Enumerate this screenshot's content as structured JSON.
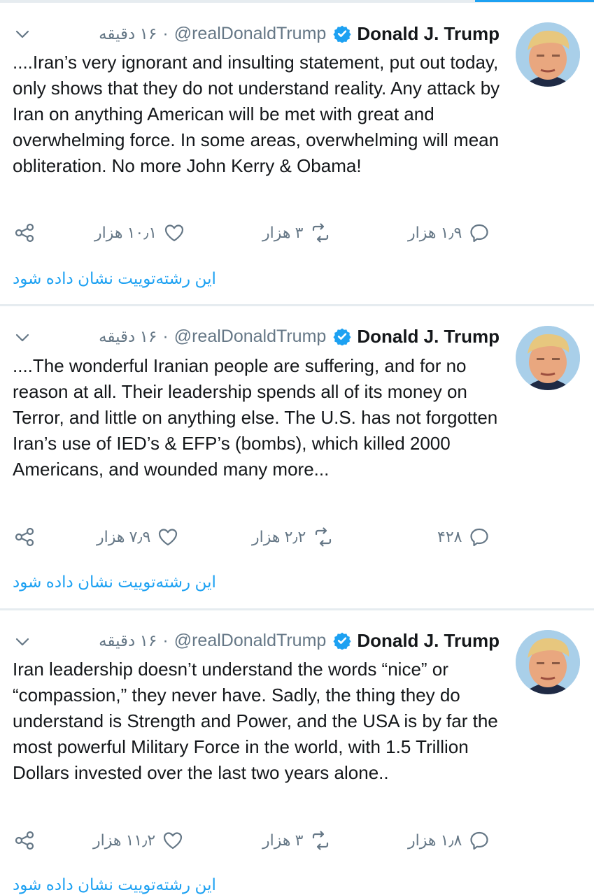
{
  "colors": {
    "accent": "#1da1f2",
    "muted": "#657786",
    "text": "#14171a",
    "divider": "#e6ecf0"
  },
  "tweets": [
    {
      "name": "Donald J. Trump",
      "handle": "@realDonaldTrump",
      "separator": "·",
      "time": "۱۶ دقیقه",
      "text": "....Iran’s very ignorant and insulting statement, put out today, only shows that they do not understand reality. Any attack by Iran on anything American will be met with great and overwhelming force. In some areas, overwhelming will mean obliteration. No more John Kerry & Obama!",
      "replies": "۱٫۹ هزار",
      "retweets": "۳ هزار",
      "likes": "۱۰٫۱ هزار",
      "show_thread": "این رشته‌توییت نشان داده شود",
      "icons": [
        "verified-badge-icon",
        "chevron-down-icon",
        "reply-icon",
        "retweet-icon",
        "like-icon",
        "share-icon"
      ]
    },
    {
      "name": "Donald J. Trump",
      "handle": "@realDonaldTrump",
      "separator": "·",
      "time": "۱۶ دقیقه",
      "text": "....The wonderful Iranian people are suffering, and for no reason at all. Their leadership spends all of its money on Terror, and little on anything else. The U.S. has not forgotten Iran’s use of IED’s & EFP’s (bombs), which killed 2000 Americans, and wounded many more...",
      "replies": "۴۲۸",
      "retweets": "۲٫۲ هزار",
      "likes": "۷٫۹ هزار",
      "show_thread": "این رشته‌توییت نشان داده شود",
      "icons": [
        "verified-badge-icon",
        "chevron-down-icon",
        "reply-icon",
        "retweet-icon",
        "like-icon",
        "share-icon"
      ]
    },
    {
      "name": "Donald J. Trump",
      "handle": "@realDonaldTrump",
      "separator": "·",
      "time": "۱۶ دقیقه",
      "text": "Iran leadership doesn’t understand the words “nice” or “compassion,” they never have. Sadly, the thing they do understand is Strength and Power, and the USA is by far the most powerful Military Force in the world, with 1.5 Trillion Dollars invested over the last two years alone..",
      "replies": "۱٫۸ هزار",
      "retweets": "۳ هزار",
      "likes": "۱۱٫۲ هزار",
      "show_thread": "این رشته‌توییت نشان داده شود",
      "icons": [
        "verified-badge-icon",
        "chevron-down-icon",
        "reply-icon",
        "retweet-icon",
        "like-icon",
        "share-icon"
      ]
    }
  ]
}
